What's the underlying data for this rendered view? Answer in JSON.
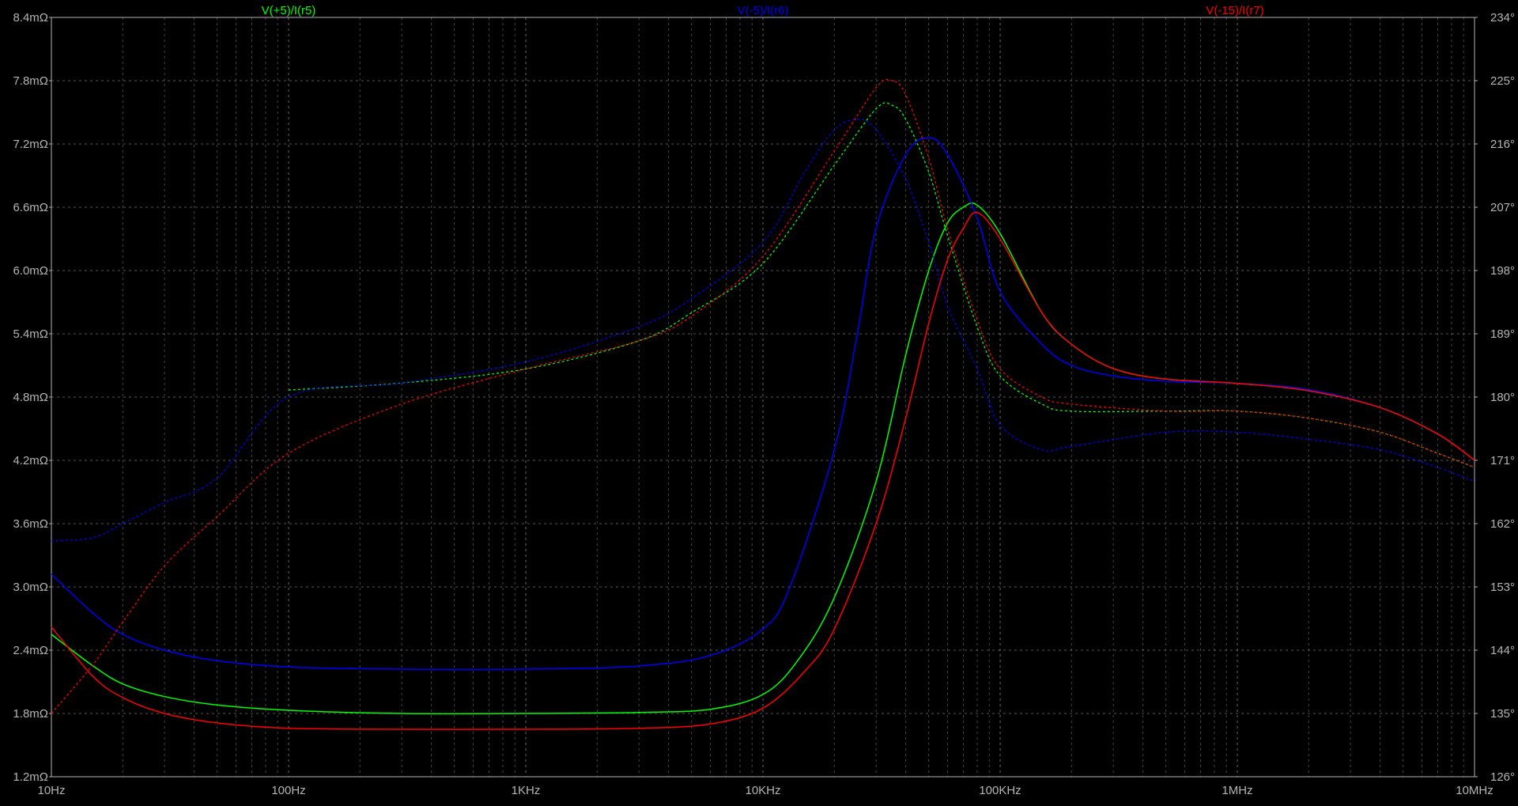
{
  "chart_data": {
    "type": "line",
    "x_scale": "log",
    "xlim": [
      10,
      10000000
    ],
    "ylim_left": [
      1.2,
      8.4
    ],
    "ylim_right": [
      126,
      234
    ],
    "x_tick_labels": [
      {
        "value": 10,
        "label": "10Hz"
      },
      {
        "value": 100,
        "label": "100Hz"
      },
      {
        "value": 1000,
        "label": "1KHz"
      },
      {
        "value": 10000,
        "label": "10KHz"
      },
      {
        "value": 100000,
        "label": "100KHz"
      },
      {
        "value": 1000000,
        "label": "1MHz"
      },
      {
        "value": 10000000,
        "label": "10MHz"
      }
    ],
    "y_left_ticks": [
      {
        "value": 8.4,
        "label": "8.4mΩ"
      },
      {
        "value": 7.8,
        "label": "7.8mΩ"
      },
      {
        "value": 7.2,
        "label": "7.2mΩ"
      },
      {
        "value": 6.6,
        "label": "6.6mΩ"
      },
      {
        "value": 6.0,
        "label": "6.0mΩ"
      },
      {
        "value": 5.4,
        "label": "5.4mΩ"
      },
      {
        "value": 4.8,
        "label": "4.8mΩ"
      },
      {
        "value": 4.2,
        "label": "4.2mΩ"
      },
      {
        "value": 3.6,
        "label": "3.6mΩ"
      },
      {
        "value": 3.0,
        "label": "3.0mΩ"
      },
      {
        "value": 2.4,
        "label": "2.4mΩ"
      },
      {
        "value": 1.8,
        "label": "1.8mΩ"
      },
      {
        "value": 1.2,
        "label": "1.2mΩ"
      }
    ],
    "y_right_ticks": [
      {
        "value": 234,
        "label": "234°"
      },
      {
        "value": 225,
        "label": "225°"
      },
      {
        "value": 216,
        "label": "216°"
      },
      {
        "value": 207,
        "label": "207°"
      },
      {
        "value": 198,
        "label": "198°"
      },
      {
        "value": 189,
        "label": "189°"
      },
      {
        "value": 180,
        "label": "180°"
      },
      {
        "value": 171,
        "label": "171°"
      },
      {
        "value": 162,
        "label": "162°"
      },
      {
        "value": 153,
        "label": "153°"
      },
      {
        "value": 144,
        "label": "144°"
      },
      {
        "value": 135,
        "label": "135°"
      },
      {
        "value": 126,
        "label": "126°"
      }
    ],
    "grid": true,
    "series": [
      {
        "name": "V(+5)/I(r5)",
        "color": "#00ff00",
        "magnitude_mohm": [
          [
            10,
            2.55
          ],
          [
            15,
            2.25
          ],
          [
            20,
            2.08
          ],
          [
            30,
            1.96
          ],
          [
            50,
            1.88
          ],
          [
            100,
            1.83
          ],
          [
            300,
            1.8
          ],
          [
            1000,
            1.8
          ],
          [
            3000,
            1.81
          ],
          [
            6000,
            1.84
          ],
          [
            10000,
            1.98
          ],
          [
            14000,
            2.3
          ],
          [
            20000,
            2.9
          ],
          [
            30000,
            4.0
          ],
          [
            40000,
            5.2
          ],
          [
            50000,
            6.0
          ],
          [
            60000,
            6.45
          ],
          [
            70000,
            6.6
          ],
          [
            80000,
            6.62
          ],
          [
            100000,
            6.35
          ],
          [
            150000,
            5.6
          ],
          [
            200000,
            5.3
          ],
          [
            300000,
            5.07
          ],
          [
            500000,
            4.97
          ],
          [
            1000000,
            4.93
          ],
          [
            2000000,
            4.86
          ],
          [
            4000000,
            4.7
          ],
          [
            7000000,
            4.45
          ],
          [
            10000000,
            4.2
          ]
        ],
        "phase_deg": [
          [
            100,
            181
          ],
          [
            300,
            182
          ],
          [
            1000,
            184
          ],
          [
            3000,
            188
          ],
          [
            5000,
            192
          ],
          [
            10000,
            199
          ],
          [
            20000,
            213
          ],
          [
            30000,
            221
          ],
          [
            35000,
            221.5
          ],
          [
            40000,
            219.5
          ],
          [
            50000,
            212
          ],
          [
            60000,
            203
          ],
          [
            80000,
            190
          ],
          [
            100000,
            183
          ],
          [
            150000,
            179
          ],
          [
            200000,
            178
          ],
          [
            500000,
            178
          ],
          [
            1000000,
            178
          ],
          [
            2000000,
            177
          ],
          [
            4000000,
            175
          ],
          [
            7000000,
            172
          ],
          [
            10000000,
            170
          ]
        ]
      },
      {
        "name": "V(-5)/I(r6)",
        "color": "#0000ff",
        "magnitude_mohm": [
          [
            10,
            3.12
          ],
          [
            15,
            2.75
          ],
          [
            20,
            2.55
          ],
          [
            30,
            2.4
          ],
          [
            50,
            2.3
          ],
          [
            100,
            2.24
          ],
          [
            300,
            2.22
          ],
          [
            1000,
            2.22
          ],
          [
            3000,
            2.25
          ],
          [
            6000,
            2.35
          ],
          [
            10000,
            2.6
          ],
          [
            13000,
            3.0
          ],
          [
            20000,
            4.3
          ],
          [
            25000,
            5.4
          ],
          [
            30000,
            6.4
          ],
          [
            40000,
            7.1
          ],
          [
            50000,
            7.26
          ],
          [
            60000,
            7.1
          ],
          [
            80000,
            6.5
          ],
          [
            100000,
            5.8
          ],
          [
            150000,
            5.3
          ],
          [
            200000,
            5.1
          ],
          [
            300000,
            5.0
          ],
          [
            500000,
            4.95
          ],
          [
            1000000,
            4.93
          ],
          [
            2000000,
            4.87
          ],
          [
            4000000,
            4.7
          ],
          [
            7000000,
            4.45
          ],
          [
            10000000,
            4.2
          ]
        ],
        "phase_deg": [
          [
            10,
            159.5
          ],
          [
            15,
            160
          ],
          [
            20,
            162
          ],
          [
            30,
            165
          ],
          [
            50,
            168.5
          ],
          [
            100,
            180
          ],
          [
            300,
            182
          ],
          [
            1000,
            185
          ],
          [
            3000,
            190
          ],
          [
            5000,
            194
          ],
          [
            10000,
            202
          ],
          [
            15000,
            212
          ],
          [
            20000,
            218
          ],
          [
            25000,
            219.5
          ],
          [
            30000,
            218
          ],
          [
            40000,
            211
          ],
          [
            50000,
            202
          ],
          [
            60000,
            193
          ],
          [
            80000,
            184
          ],
          [
            100000,
            176
          ],
          [
            150000,
            172.5
          ],
          [
            200000,
            173
          ],
          [
            500000,
            175
          ],
          [
            1000000,
            175
          ],
          [
            2000000,
            174
          ],
          [
            4000000,
            172.5
          ],
          [
            7000000,
            170
          ],
          [
            10000000,
            168
          ]
        ]
      },
      {
        "name": "V(-15)/I(r7)",
        "color": "#ff0000",
        "magnitude_mohm": [
          [
            10,
            2.62
          ],
          [
            15,
            2.15
          ],
          [
            20,
            1.95
          ],
          [
            30,
            1.8
          ],
          [
            50,
            1.71
          ],
          [
            100,
            1.66
          ],
          [
            300,
            1.65
          ],
          [
            1000,
            1.65
          ],
          [
            3000,
            1.66
          ],
          [
            6000,
            1.7
          ],
          [
            10000,
            1.85
          ],
          [
            15000,
            2.2
          ],
          [
            20000,
            2.6
          ],
          [
            30000,
            3.6
          ],
          [
            40000,
            4.6
          ],
          [
            50000,
            5.5
          ],
          [
            60000,
            6.1
          ],
          [
            70000,
            6.4
          ],
          [
            80000,
            6.55
          ],
          [
            100000,
            6.3
          ],
          [
            150000,
            5.6
          ],
          [
            200000,
            5.3
          ],
          [
            300000,
            5.07
          ],
          [
            500000,
            4.97
          ],
          [
            1000000,
            4.93
          ],
          [
            2000000,
            4.86
          ],
          [
            4000000,
            4.7
          ],
          [
            7000000,
            4.45
          ],
          [
            10000000,
            4.2
          ]
        ],
        "phase_deg": [
          [
            10,
            135
          ],
          [
            15,
            142
          ],
          [
            20,
            148
          ],
          [
            30,
            156
          ],
          [
            50,
            163
          ],
          [
            100,
            172
          ],
          [
            300,
            179
          ],
          [
            1000,
            184
          ],
          [
            3000,
            188
          ],
          [
            5000,
            191.5
          ],
          [
            10000,
            200
          ],
          [
            20000,
            215
          ],
          [
            30000,
            224
          ],
          [
            35000,
            225
          ],
          [
            40000,
            223
          ],
          [
            50000,
            214
          ],
          [
            60000,
            204
          ],
          [
            80000,
            191
          ],
          [
            100000,
            184
          ],
          [
            150000,
            180
          ],
          [
            200000,
            179
          ],
          [
            500000,
            178
          ],
          [
            1000000,
            178
          ],
          [
            2000000,
            177
          ],
          [
            4000000,
            175
          ],
          [
            7000000,
            172
          ],
          [
            10000000,
            170
          ]
        ]
      }
    ]
  }
}
